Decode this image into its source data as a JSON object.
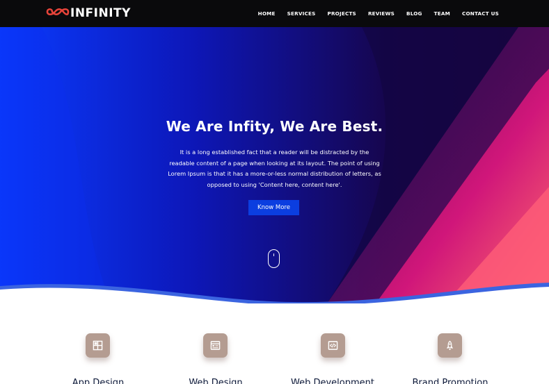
{
  "brand": {
    "name": "INFINITY",
    "logo_icon": "infinity-icon",
    "accent": "#e8443a"
  },
  "nav": {
    "items": [
      {
        "label": "HOME"
      },
      {
        "label": "SERVICES"
      },
      {
        "label": "PROJECTS"
      },
      {
        "label": "REVIEWS"
      },
      {
        "label": "BLOG"
      },
      {
        "label": "TEAM"
      },
      {
        "label": "CONTACT US"
      }
    ]
  },
  "hero": {
    "title": "We Are Infity, We Are Best.",
    "text": "It is a long established fact that a reader will be distracted by the readable content of a page when looking at its layout. The point of using Lorem Ipsum is that it has a more-or-less normal distribution of letters, as opposed to using 'Content here, content here'.",
    "button_label": "Know More",
    "button_color": "#0b3ee0",
    "scroll_icon": "mouse-scroll-icon"
  },
  "services": {
    "items": [
      {
        "title": "App Design",
        "icon": "layout-grid-icon"
      },
      {
        "title": "Web Design",
        "icon": "browser-window-icon"
      },
      {
        "title": "Web Development",
        "icon": "code-icon"
      },
      {
        "title": "Brand Promotion",
        "icon": "rocket-icon"
      }
    ],
    "icon_bg": "#b49c91"
  }
}
